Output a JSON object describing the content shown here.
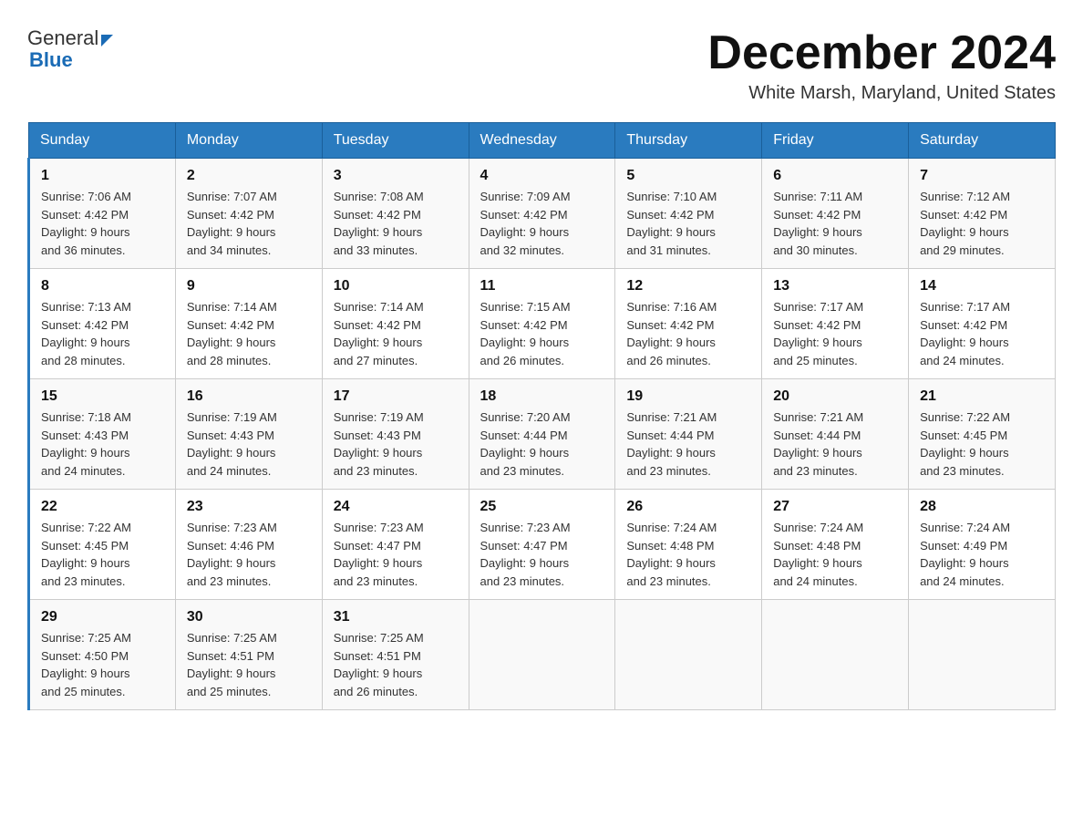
{
  "header": {
    "logo_general": "General",
    "logo_blue": "Blue",
    "month_title": "December 2024",
    "location": "White Marsh, Maryland, United States"
  },
  "days_of_week": [
    "Sunday",
    "Monday",
    "Tuesday",
    "Wednesday",
    "Thursday",
    "Friday",
    "Saturday"
  ],
  "weeks": [
    [
      {
        "day": "1",
        "sunrise": "7:06 AM",
        "sunset": "4:42 PM",
        "daylight": "9 hours and 36 minutes."
      },
      {
        "day": "2",
        "sunrise": "7:07 AM",
        "sunset": "4:42 PM",
        "daylight": "9 hours and 34 minutes."
      },
      {
        "day": "3",
        "sunrise": "7:08 AM",
        "sunset": "4:42 PM",
        "daylight": "9 hours and 33 minutes."
      },
      {
        "day": "4",
        "sunrise": "7:09 AM",
        "sunset": "4:42 PM",
        "daylight": "9 hours and 32 minutes."
      },
      {
        "day": "5",
        "sunrise": "7:10 AM",
        "sunset": "4:42 PM",
        "daylight": "9 hours and 31 minutes."
      },
      {
        "day": "6",
        "sunrise": "7:11 AM",
        "sunset": "4:42 PM",
        "daylight": "9 hours and 30 minutes."
      },
      {
        "day": "7",
        "sunrise": "7:12 AM",
        "sunset": "4:42 PM",
        "daylight": "9 hours and 29 minutes."
      }
    ],
    [
      {
        "day": "8",
        "sunrise": "7:13 AM",
        "sunset": "4:42 PM",
        "daylight": "9 hours and 28 minutes."
      },
      {
        "day": "9",
        "sunrise": "7:14 AM",
        "sunset": "4:42 PM",
        "daylight": "9 hours and 28 minutes."
      },
      {
        "day": "10",
        "sunrise": "7:14 AM",
        "sunset": "4:42 PM",
        "daylight": "9 hours and 27 minutes."
      },
      {
        "day": "11",
        "sunrise": "7:15 AM",
        "sunset": "4:42 PM",
        "daylight": "9 hours and 26 minutes."
      },
      {
        "day": "12",
        "sunrise": "7:16 AM",
        "sunset": "4:42 PM",
        "daylight": "9 hours and 26 minutes."
      },
      {
        "day": "13",
        "sunrise": "7:17 AM",
        "sunset": "4:42 PM",
        "daylight": "9 hours and 25 minutes."
      },
      {
        "day": "14",
        "sunrise": "7:17 AM",
        "sunset": "4:42 PM",
        "daylight": "9 hours and 24 minutes."
      }
    ],
    [
      {
        "day": "15",
        "sunrise": "7:18 AM",
        "sunset": "4:43 PM",
        "daylight": "9 hours and 24 minutes."
      },
      {
        "day": "16",
        "sunrise": "7:19 AM",
        "sunset": "4:43 PM",
        "daylight": "9 hours and 24 minutes."
      },
      {
        "day": "17",
        "sunrise": "7:19 AM",
        "sunset": "4:43 PM",
        "daylight": "9 hours and 23 minutes."
      },
      {
        "day": "18",
        "sunrise": "7:20 AM",
        "sunset": "4:44 PM",
        "daylight": "9 hours and 23 minutes."
      },
      {
        "day": "19",
        "sunrise": "7:21 AM",
        "sunset": "4:44 PM",
        "daylight": "9 hours and 23 minutes."
      },
      {
        "day": "20",
        "sunrise": "7:21 AM",
        "sunset": "4:44 PM",
        "daylight": "9 hours and 23 minutes."
      },
      {
        "day": "21",
        "sunrise": "7:22 AM",
        "sunset": "4:45 PM",
        "daylight": "9 hours and 23 minutes."
      }
    ],
    [
      {
        "day": "22",
        "sunrise": "7:22 AM",
        "sunset": "4:45 PM",
        "daylight": "9 hours and 23 minutes."
      },
      {
        "day": "23",
        "sunrise": "7:23 AM",
        "sunset": "4:46 PM",
        "daylight": "9 hours and 23 minutes."
      },
      {
        "day": "24",
        "sunrise": "7:23 AM",
        "sunset": "4:47 PM",
        "daylight": "9 hours and 23 minutes."
      },
      {
        "day": "25",
        "sunrise": "7:23 AM",
        "sunset": "4:47 PM",
        "daylight": "9 hours and 23 minutes."
      },
      {
        "day": "26",
        "sunrise": "7:24 AM",
        "sunset": "4:48 PM",
        "daylight": "9 hours and 23 minutes."
      },
      {
        "day": "27",
        "sunrise": "7:24 AM",
        "sunset": "4:48 PM",
        "daylight": "9 hours and 24 minutes."
      },
      {
        "day": "28",
        "sunrise": "7:24 AM",
        "sunset": "4:49 PM",
        "daylight": "9 hours and 24 minutes."
      }
    ],
    [
      {
        "day": "29",
        "sunrise": "7:25 AM",
        "sunset": "4:50 PM",
        "daylight": "9 hours and 25 minutes."
      },
      {
        "day": "30",
        "sunrise": "7:25 AM",
        "sunset": "4:51 PM",
        "daylight": "9 hours and 25 minutes."
      },
      {
        "day": "31",
        "sunrise": "7:25 AM",
        "sunset": "4:51 PM",
        "daylight": "9 hours and 26 minutes."
      },
      null,
      null,
      null,
      null
    ]
  ],
  "labels": {
    "sunrise": "Sunrise:",
    "sunset": "Sunset:",
    "daylight": "Daylight:"
  }
}
